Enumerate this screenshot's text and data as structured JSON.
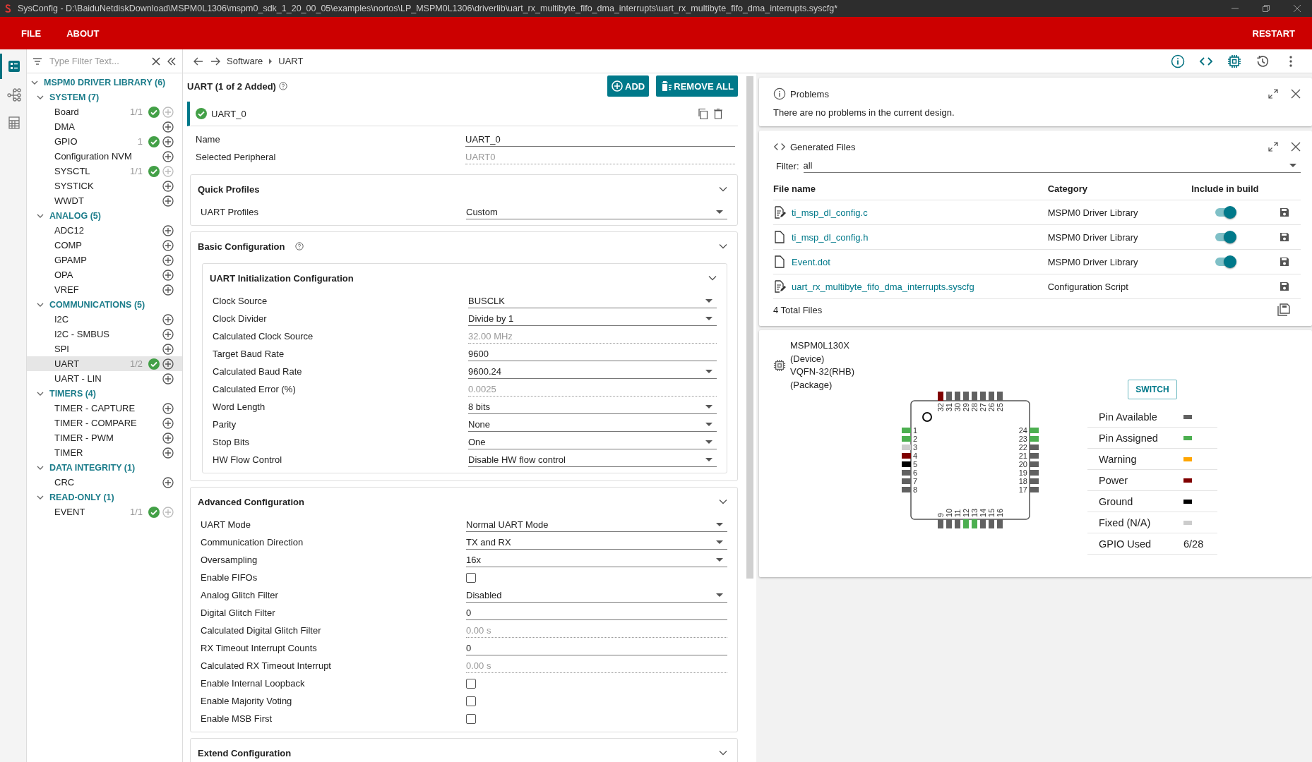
{
  "window": {
    "title": "SysConfig - D:\\BaiduNetdiskDownload\\MSPM0L1306\\mspm0_sdk_1_20_00_05\\examples\\nortos\\LP_MSPM0L1306\\driverlib\\uart_rx_multibyte_fifo_dma_interrupts\\uart_rx_multibyte_fifo_dma_interrupts.syscfg*"
  },
  "menu": [
    {
      "label": "FILE"
    },
    {
      "label": "ABOUT"
    }
  ],
  "restart": "RESTART",
  "rail": [
    {
      "kind": "list",
      "selected": true
    },
    {
      "kind": "network",
      "selected": false
    },
    {
      "kind": "calculator",
      "selected": false
    }
  ],
  "filter": {
    "placeholder": "Type Filter Text..."
  },
  "breadcrumb": [
    "Software",
    "UART"
  ],
  "sidebar": {
    "tree": [
      {
        "label": "MSPM0 DRIVER LIBRARY (6)",
        "expanded": true,
        "children": [
          {
            "label": "SYSTEM (7)",
            "expanded": true,
            "children": [
              {
                "label": "Board",
                "count": "1/1",
                "added": true,
                "add_disabled": true,
                "selected": false
              },
              {
                "label": "DMA",
                "added": false,
                "add_disabled": false,
                "selected": false
              },
              {
                "label": "GPIO",
                "count": "1",
                "added": true,
                "add_disabled": false,
                "selected": false
              },
              {
                "label": "Configuration NVM",
                "added": false,
                "add_disabled": false,
                "selected": false
              },
              {
                "label": "SYSCTL",
                "count": "1/1",
                "added": true,
                "add_disabled": true,
                "selected": false
              },
              {
                "label": "SYSTICK",
                "added": false,
                "add_disabled": false,
                "selected": false
              },
              {
                "label": "WWDT",
                "added": false,
                "add_disabled": false,
                "selected": false
              }
            ]
          },
          {
            "label": "ANALOG (5)",
            "expanded": true,
            "children": [
              {
                "label": "ADC12",
                "added": false,
                "add_disabled": false,
                "selected": false
              },
              {
                "label": "COMP",
                "added": false,
                "add_disabled": false,
                "selected": false
              },
              {
                "label": "GPAMP",
                "added": false,
                "add_disabled": false,
                "selected": false
              },
              {
                "label": "OPA",
                "added": false,
                "add_disabled": false,
                "selected": false
              },
              {
                "label": "VREF",
                "added": false,
                "add_disabled": false,
                "selected": false
              }
            ]
          },
          {
            "label": "COMMUNICATIONS (5)",
            "expanded": true,
            "children": [
              {
                "label": "I2C",
                "added": false,
                "add_disabled": false,
                "selected": false
              },
              {
                "label": "I2C - SMBUS",
                "added": false,
                "add_disabled": false,
                "selected": false
              },
              {
                "label": "SPI",
                "added": false,
                "add_disabled": false,
                "selected": false
              },
              {
                "label": "UART",
                "count": "1/2",
                "added": true,
                "add_disabled": false,
                "selected": true
              },
              {
                "label": "UART - LIN",
                "added": false,
                "add_disabled": false,
                "selected": false
              }
            ]
          },
          {
            "label": "TIMERS (4)",
            "expanded": true,
            "children": [
              {
                "label": "TIMER - CAPTURE",
                "added": false,
                "add_disabled": false,
                "selected": false
              },
              {
                "label": "TIMER - COMPARE",
                "added": false,
                "add_disabled": false,
                "selected": false
              },
              {
                "label": "TIMER - PWM",
                "added": false,
                "add_disabled": false,
                "selected": false
              },
              {
                "label": "TIMER",
                "added": false,
                "add_disabled": false,
                "selected": false
              }
            ]
          },
          {
            "label": "DATA INTEGRITY (1)",
            "expanded": true,
            "children": [
              {
                "label": "CRC",
                "added": false,
                "add_disabled": false,
                "selected": false
              }
            ]
          },
          {
            "label": "READ-ONLY (1)",
            "expanded": true,
            "children": [
              {
                "label": "EVENT",
                "count": "1/1",
                "added": true,
                "add_disabled": true,
                "selected": false
              }
            ]
          }
        ]
      }
    ]
  },
  "module": {
    "title": "UART (1 of 2 Added)",
    "buttons": [
      {
        "kind": "add",
        "label": "ADD"
      },
      {
        "kind": "remove",
        "label": "REMOVE ALL"
      }
    ],
    "instance": {
      "name": "UART_0",
      "valid": true
    },
    "fields": [
      {
        "label": "Name",
        "value": "UART_0",
        "kind": "text"
      },
      {
        "label": "Selected Peripheral",
        "value": "UART0",
        "kind": "readonly"
      }
    ],
    "sections": [
      {
        "title": "Quick Profiles",
        "help": false,
        "fields": [
          {
            "label": "UART Profiles",
            "value": "Custom",
            "kind": "select"
          }
        ]
      },
      {
        "title": "Basic Configuration",
        "help": true,
        "subsections": [
          {
            "title": "UART Initialization Configuration",
            "fields": [
              {
                "label": "Clock Source",
                "value": "BUSCLK",
                "kind": "select"
              },
              {
                "label": "Clock Divider",
                "value": "Divide by 1",
                "kind": "select"
              },
              {
                "label": "Calculated Clock Source",
                "value": "32.00 MHz",
                "kind": "readonly"
              },
              {
                "label": "Target Baud Rate",
                "value": "9600",
                "kind": "text"
              },
              {
                "label": "Calculated Baud Rate",
                "value": "9600.24",
                "kind": "select"
              },
              {
                "label": "Calculated Error (%)",
                "value": "0.0025",
                "kind": "readonly"
              },
              {
                "label": "Word Length",
                "value": "8 bits",
                "kind": "select"
              },
              {
                "label": "Parity",
                "value": "None",
                "kind": "select"
              },
              {
                "label": "Stop Bits",
                "value": "One",
                "kind": "select"
              },
              {
                "label": "HW Flow Control",
                "value": "Disable HW flow control",
                "kind": "select"
              }
            ]
          }
        ]
      },
      {
        "title": "Advanced Configuration",
        "help": false,
        "fields": [
          {
            "label": "UART Mode",
            "value": "Normal UART Mode",
            "kind": "select"
          },
          {
            "label": "Communication Direction",
            "value": "TX and RX",
            "kind": "select"
          },
          {
            "label": "Oversampling",
            "value": "16x",
            "kind": "select"
          },
          {
            "label": "Enable FIFOs",
            "kind": "checkbox",
            "checked": false
          },
          {
            "label": "Analog Glitch Filter",
            "value": "Disabled",
            "kind": "select"
          },
          {
            "label": "Digital Glitch Filter",
            "value": "0",
            "kind": "text"
          },
          {
            "label": "Calculated Digital Glitch Filter",
            "value": "0.00 s",
            "kind": "readonly"
          },
          {
            "label": "RX Timeout Interrupt Counts",
            "value": "0",
            "kind": "text"
          },
          {
            "label": "Calculated RX Timeout Interrupt",
            "value": "0.00 s",
            "kind": "readonly"
          },
          {
            "label": "Enable Internal Loopback",
            "kind": "checkbox",
            "checked": false
          },
          {
            "label": "Enable Majority Voting",
            "kind": "checkbox",
            "checked": false
          },
          {
            "label": "Enable MSB First",
            "kind": "checkbox",
            "checked": false
          }
        ]
      },
      {
        "title": "Extend Configuration",
        "help": false
      }
    ]
  },
  "problems": {
    "title": "Problems",
    "message": "There are no problems in the current design."
  },
  "generated_files": {
    "title": "Generated Files",
    "filter_label": "Filter:",
    "filter_value": "all",
    "columns": [
      "File name",
      "Category",
      "Include in build"
    ],
    "rows": [
      {
        "name": "ti_msp_dl_config.c",
        "category": "MSPM0 Driver Library",
        "kind": "source",
        "include": true
      },
      {
        "name": "ti_msp_dl_config.h",
        "category": "MSPM0 Driver Library",
        "kind": "file",
        "include": true
      },
      {
        "name": "Event.dot",
        "category": "MSPM0 Driver Library",
        "kind": "file",
        "include": true
      },
      {
        "name": "uart_rx_multibyte_fifo_dma_interrupts.syscfg",
        "category": "Configuration Script",
        "kind": "source"
      }
    ],
    "total": "4 Total Files"
  },
  "device": {
    "lines": [
      "MSPM0L130X",
      "(Device)",
      "VQFN-32(RHB)",
      "(Package)"
    ],
    "switch": "SWITCH",
    "pins": {
      "top": [
        {
          "number": "32",
          "color": "#800000"
        },
        {
          "number": "31",
          "color": "#616161"
        },
        {
          "number": "30",
          "color": "#616161"
        },
        {
          "number": "29",
          "color": "#616161"
        },
        {
          "number": "28",
          "color": "#616161"
        },
        {
          "number": "27",
          "color": "#616161"
        },
        {
          "number": "26",
          "color": "#616161"
        },
        {
          "number": "25",
          "color": "#616161"
        }
      ],
      "left": [
        {
          "number": "1",
          "color": "#4caf50"
        },
        {
          "number": "2",
          "color": "#4caf50"
        },
        {
          "number": "3",
          "color": "#cccccc"
        },
        {
          "number": "4",
          "color": "#800000"
        },
        {
          "number": "5",
          "color": "#000000"
        },
        {
          "number": "6",
          "color": "#616161"
        },
        {
          "number": "7",
          "color": "#616161"
        },
        {
          "number": "8",
          "color": "#616161"
        }
      ],
      "right": [
        {
          "number": "24",
          "color": "#4caf50"
        },
        {
          "number": "23",
          "color": "#4caf50"
        },
        {
          "number": "22",
          "color": "#616161"
        },
        {
          "number": "21",
          "color": "#616161"
        },
        {
          "number": "20",
          "color": "#616161"
        },
        {
          "number": "19",
          "color": "#616161"
        },
        {
          "number": "18",
          "color": "#616161"
        },
        {
          "number": "17",
          "color": "#616161"
        }
      ],
      "bottom": [
        {
          "number": "9",
          "color": "#616161"
        },
        {
          "number": "10",
          "color": "#616161"
        },
        {
          "number": "11",
          "color": "#616161"
        },
        {
          "number": "12",
          "color": "#4caf50"
        },
        {
          "number": "13",
          "color": "#4caf50"
        },
        {
          "number": "14",
          "color": "#616161"
        },
        {
          "number": "15",
          "color": "#616161"
        },
        {
          "number": "16",
          "color": "#616161"
        }
      ]
    },
    "legend": [
      {
        "label": "Pin Available",
        "color": "#616161"
      },
      {
        "label": "Pin Assigned",
        "color": "#4caf50"
      },
      {
        "label": "Warning",
        "color": "#ffa500"
      },
      {
        "label": "Power",
        "color": "#800000"
      },
      {
        "label": "Ground",
        "color": "#000000"
      },
      {
        "label": "Fixed (N/A)",
        "color": "#cccccc"
      }
    ],
    "gpio": {
      "label": "GPIO Used",
      "value": "6/28"
    }
  }
}
